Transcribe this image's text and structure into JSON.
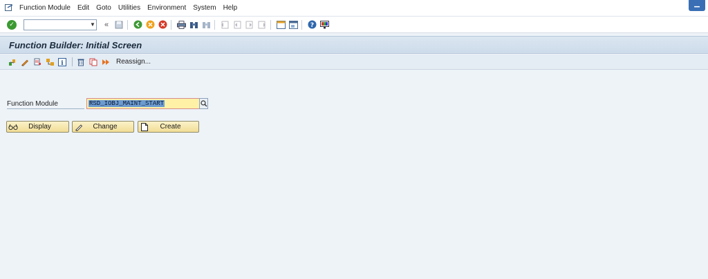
{
  "menubar": {
    "items": [
      "Function Module",
      "Edit",
      "Goto",
      "Utilities",
      "Environment",
      "System",
      "Help"
    ]
  },
  "toolbar": {
    "command_field_value": ""
  },
  "title": "Function Builder: Initial Screen",
  "app_toolbar": {
    "reassign_label": "Reassign..."
  },
  "form": {
    "function_module_label": "Function Module",
    "function_module_value": "RSD_IOBJ_MAINT_START"
  },
  "buttons": {
    "display": "Display",
    "change": "Change",
    "create": "Create"
  },
  "colors": {
    "background": "#eef3f8",
    "title_bar": "#cddbea",
    "input_highlight": "#fff2a6",
    "button": "#f1dd95",
    "ok_green": "#3c9a32"
  }
}
